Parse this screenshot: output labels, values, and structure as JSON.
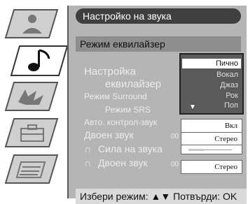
{
  "header": {
    "title": "Настройко на звука"
  },
  "mode_bar": {
    "label": "Режим еквилайзер"
  },
  "settings": {
    "equalizer_line1": "Настройка",
    "equalizer_line2": "еквилайзер",
    "surround": "Режим Surround",
    "srs": "Режим SRS",
    "auto_volume": "Авто. контрол-звук",
    "dual_sound": "Двоен звук",
    "volume": "Сила на звука",
    "dual_sound_2": "Двоен звук",
    "num_a": "00",
    "num_b": "00"
  },
  "dropdown": {
    "options": [
      "Пично",
      "Вокал",
      "Джаз",
      "Рок",
      "Поп"
    ],
    "selected": "Пично"
  },
  "values": {
    "auto_volume": "Вкл",
    "dual_sound": "Стерео",
    "volume_level": 0.35,
    "dual_sound_2": "Стерео"
  },
  "footer": {
    "hint": "Избери режим: ▲▼  Потвърди: OK"
  },
  "sidebar": {
    "tabs": [
      "picture",
      "sound",
      "channels",
      "features",
      "settings"
    ],
    "active": "sound"
  }
}
